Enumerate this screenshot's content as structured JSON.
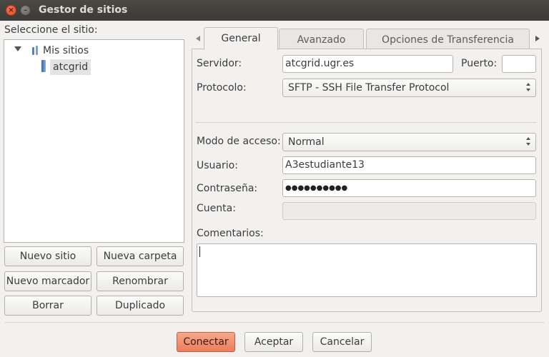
{
  "window": {
    "title": "Gestor de sitios",
    "close_glyph": "×",
    "minimize_glyph": "–"
  },
  "site_selector": {
    "label": "Seleccione el sitio:",
    "tree": {
      "root_label": "Mis sitios",
      "site_label": "atcgrid"
    },
    "buttons": {
      "new_site": "Nuevo sitio",
      "new_folder": "Nueva carpeta",
      "new_bookmark": "Nuevo marcador",
      "rename": "Renombrar",
      "delete": "Borrar",
      "duplicate": "Duplicado"
    }
  },
  "tabs": [
    "General",
    "Avanzado",
    "Opciones de Transferencia"
  ],
  "active_tab": "General",
  "form": {
    "server_label": "Servidor:",
    "server_value": "atcgrid.ugr.es",
    "port_label": "Puerto:",
    "port_value": "",
    "protocol_label": "Protocolo:",
    "protocol_value": "SFTP - SSH File Transfer Protocol",
    "access_mode_label": "Modo de acceso:",
    "access_mode_value": "Normal",
    "user_label": "Usuario:",
    "user_value": "A3estudiante13",
    "password_label": "Contraseña:",
    "password_mask": "●●●●●●●●●●",
    "account_label": "Cuenta:",
    "account_value": "",
    "comments_label": "Comentarios:",
    "comments_value": ""
  },
  "dialog_buttons": {
    "connect": "Conectar",
    "accept": "Aceptar",
    "cancel": "Cancelar"
  },
  "colors": {
    "titlebar": "#3c3b37",
    "primary_button": "#ec7d5e",
    "selection": "#e5e4e2"
  },
  "icons": {
    "root": "folder-icon",
    "site": "server-icon"
  }
}
